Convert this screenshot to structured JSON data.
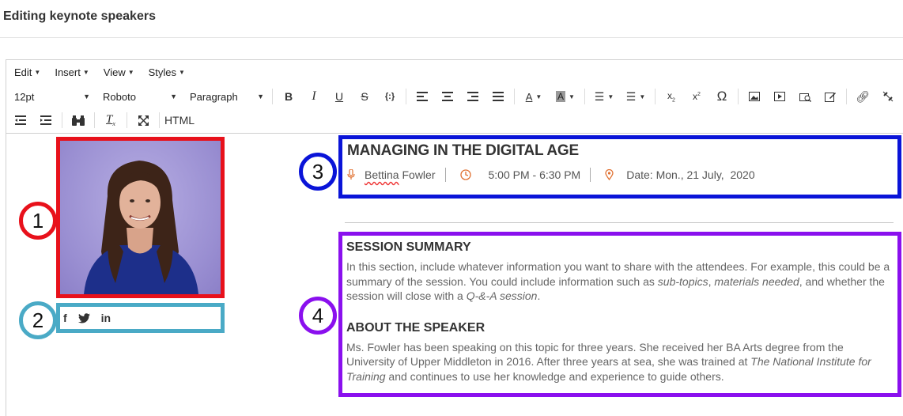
{
  "page": {
    "title": "Editing keynote speakers"
  },
  "menubar": {
    "items": [
      "Edit",
      "Insert",
      "View",
      "Styles"
    ]
  },
  "toolbar": {
    "font_size": "12pt",
    "font_family": "Roboto",
    "block_format": "Paragraph",
    "html_label": "HTML",
    "icons": [
      "bold-icon",
      "italic-icon",
      "underline-icon",
      "strikethrough-icon",
      "source-code-icon",
      "align-left-icon",
      "align-center-icon",
      "align-right-icon",
      "justify-icon",
      "text-color-icon",
      "background-color-icon",
      "bullet-list-icon",
      "numbered-list-icon",
      "subscript-icon",
      "superscript-icon",
      "omega-icon",
      "image-icon",
      "media-icon",
      "image-manager-icon",
      "edit-icon",
      "link-icon",
      "unlink-icon",
      "outdent-icon",
      "indent-icon",
      "find-icon",
      "clear-format-icon",
      "fullscreen-icon"
    ]
  },
  "markers": [
    "1",
    "2",
    "3",
    "4"
  ],
  "social": {
    "facebook": "f",
    "linkedin": "in"
  },
  "session": {
    "title": "MANAGING IN THE DIGITAL AGE",
    "speaker_first": "Bettina",
    "speaker_last": "Fowler",
    "time": "5:00 PM - 6:30 PM",
    "date": "Date: Mon., 21 July,  2020"
  },
  "summary": {
    "heading": "SESSION SUMMARY",
    "p1": "In this section, include whatever information you want to share with the attendees. For example, this could be a summary of the session. You could include information such as ",
    "em1": "sub-topics",
    "p2": ", ",
    "em2": "materials needed",
    "p3": ", and whether the session will close with a ",
    "em3": "Q-&-A session",
    "p4": "."
  },
  "speaker": {
    "heading": "ABOUT THE SPEAKER",
    "p1": "Ms. Fowler has been speaking on this topic for three years. She received her BA Arts degree from the University of Upper Middleton in 2016. After three years at sea, she was trained at ",
    "em1": "The National Institute for Training",
    "p2": " and continues to use her knowledge and experience to guide others."
  },
  "colors": {
    "marker1": "#e8111b",
    "marker2": "#4aaac6",
    "marker3": "#0a14d8",
    "marker4": "#8a10ee",
    "meta_icon": "#e07030"
  }
}
